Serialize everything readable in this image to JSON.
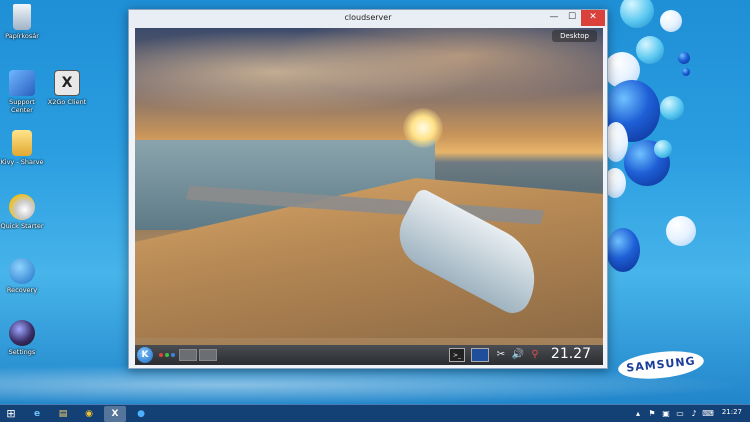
{
  "desktop": {
    "icons": [
      {
        "label": "Papírkosár",
        "name": "recycle-bin"
      },
      {
        "label": "Support Center",
        "name": "support-center"
      },
      {
        "label": "X2Go Client",
        "name": "x2go-client"
      },
      {
        "label": "Kivy - Sharve",
        "name": "kivy-share"
      },
      {
        "label": "Quick Starter",
        "name": "quick-starter"
      },
      {
        "label": "Recovery",
        "name": "recovery"
      },
      {
        "label": "Settings",
        "name": "settings"
      }
    ],
    "brand_logo": "SAMSUNG"
  },
  "window": {
    "title": "cloudserver",
    "min_glyph": "—",
    "max_glyph": "☐",
    "close_glyph": "✕"
  },
  "remote": {
    "desktop_button": "Desktop",
    "clock": "21.27",
    "tray_icons": [
      "terminal-icon",
      "screen-icon",
      "scissors-icon",
      "volume-icon",
      "network-icon"
    ]
  },
  "taskbar": {
    "clock": "21:27",
    "apps": [
      "internet-explorer-icon",
      "file-explorer-icon",
      "chrome-icon",
      "x2go-icon",
      "app-icon"
    ]
  },
  "colors": {
    "accent": "#1f8fd6",
    "close": "#d9413a",
    "samsung_blue": "#1a3d9a"
  }
}
